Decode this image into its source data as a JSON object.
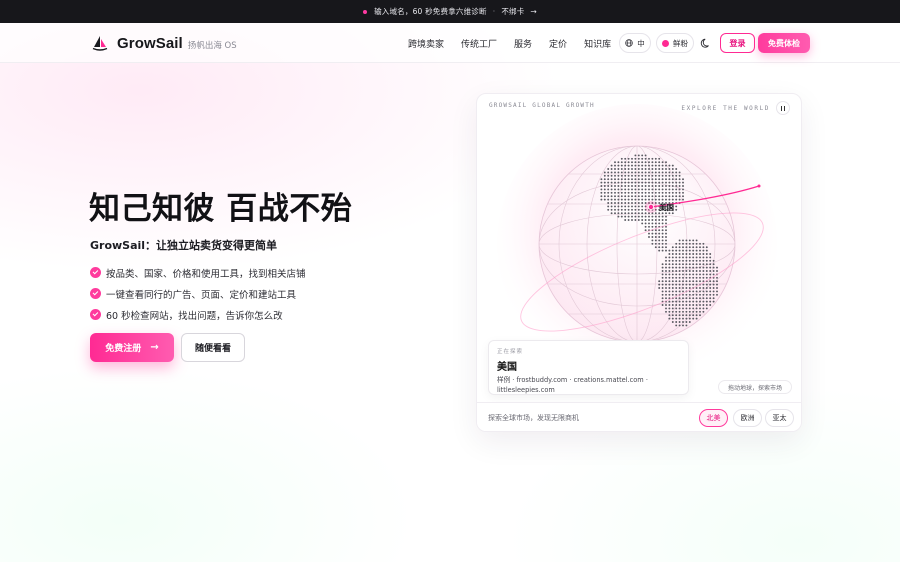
{
  "announcement": {
    "text": "输入域名，60 秒免费拿六维诊断",
    "separator": "·",
    "note": "不绑卡",
    "arrow": "→"
  },
  "header": {
    "brand": "GrowSail",
    "tagline": "扬帆出海 OS",
    "nav": [
      "跨境卖家",
      "传统工厂",
      "服务",
      "定价",
      "知识库"
    ],
    "language": "中",
    "theme": "鲜粉",
    "login": "登录",
    "free_trial": "免费体检"
  },
  "hero": {
    "title": "知己知彼 百战不殆",
    "subtitle": "GrowSail：让独立站卖货变得更简单",
    "features": [
      "按品类、国家、价格和使用工具，找到相关店铺",
      "一键查看同行的广告、页面、定价和建站工具",
      "60 秒检查网站，找出问题，告诉你怎么改"
    ],
    "signup_button": "免费注册",
    "signup_arrow": "→",
    "browse_button": "随便看看"
  },
  "globe_card": {
    "label_left": "GROWSAIL GLOBAL GROWTH",
    "label_right": "EXPLORE THE WORLD",
    "marker_label": "美国",
    "explore_kicker": "正在探索",
    "explore_country": "美国",
    "explore_examples": "样例 · frostbuddy.com · creations.mattel.com · littlesleepies.com",
    "hint": "拖动地球，探索市场",
    "footer_text": "探索全球市场，发现无限商机",
    "regions": [
      "北美",
      "欧洲",
      "亚太"
    ],
    "active_region": "北美"
  },
  "colors": {
    "accent": "#ff2a93",
    "accent_light": "#ff5cb0",
    "topbar_bg": "#17171b"
  }
}
